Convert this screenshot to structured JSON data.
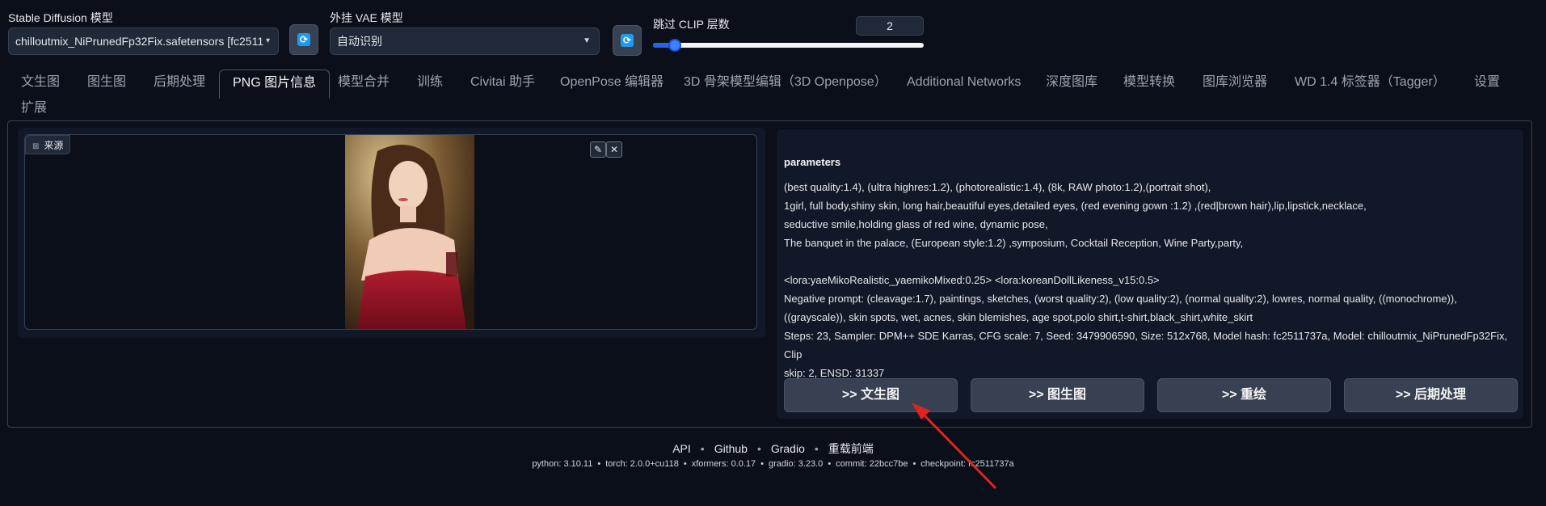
{
  "top": {
    "sd_model_label": "Stable Diffusion 模型",
    "sd_model_value": "chilloutmix_NiPrunedFp32Fix.safetensors [fc2511",
    "vae_label": "外挂 VAE 模型",
    "vae_value": "自动识别",
    "clip_label": "跳过 CLIP 层数",
    "clip_value": "2",
    "clip_fraction": 0.08
  },
  "tabs": [
    {
      "label": "文生图"
    },
    {
      "label": "图生图"
    },
    {
      "label": "后期处理"
    },
    {
      "label": "PNG 图片信息"
    },
    {
      "label": "模型合并"
    },
    {
      "label": "训练"
    },
    {
      "label": "Civitai 助手"
    },
    {
      "label": "OpenPose 编辑器"
    },
    {
      "label": "3D 骨架模型编辑（3D Openpose）"
    },
    {
      "label": "Additional Networks"
    },
    {
      "label": "深度图库"
    },
    {
      "label": "模型转换"
    },
    {
      "label": "图库浏览器"
    },
    {
      "label": "WD 1.4 标签器（Tagger）"
    },
    {
      "label": "设置"
    },
    {
      "label": "扩展"
    }
  ],
  "active_tab": "PNG 图片信息",
  "image_panel": {
    "source_label": "来源"
  },
  "info": {
    "title": "parameters",
    "text": "(best quality:1.4), (ultra highres:1.2), (photorealistic:1.4), (8k, RAW photo:1.2),(portrait shot),\n1girl, full body,shiny skin, long hair,beautiful eyes,detailed eyes, (red evening gown :1.2) ,(red|brown hair),lip,lipstick,necklace,\nseductive smile,holding glass of red wine, dynamic pose,\nThe banquet in the palace, (European style:1.2) ,symposium, Cocktail Reception, Wine Party,party,\n\n<lora:yaeMikoRealistic_yaemikoMixed:0.25> <lora:koreanDollLikeness_v15:0.5>\nNegative prompt: (cleavage:1.7), paintings, sketches, (worst quality:2), (low quality:2), (normal quality:2), lowres, normal quality, ((monochrome)),\n((grayscale)), skin spots, wet, acnes, skin blemishes, age spot,polo shirt,t-shirt,black_shirt,white_skirt\nSteps: 23, Sampler: DPM++ SDE Karras, CFG scale: 7, Seed: 3479906590, Size: 512x768, Model hash: fc2511737a, Model: chilloutmix_NiPrunedFp32Fix, Clip\nskip: 2, ENSD: 31337"
  },
  "actions": [
    {
      "label": ">> 文生图"
    },
    {
      "label": ">> 图生图"
    },
    {
      "label": ">> 重绘"
    },
    {
      "label": ">> 后期处理"
    }
  ],
  "footer": {
    "links": [
      "API",
      "Github",
      "Gradio",
      "重载前端"
    ],
    "info": [
      "python: 3.10.11",
      "torch: 2.0.0+cu118",
      "xformers: 0.0.17",
      "gradio: 3.23.0",
      "commit: 22bcc7be",
      "checkpoint: fc2511737a"
    ]
  },
  "colors": {
    "background": "#0b0f19",
    "accent": "#3b82f6",
    "annotation_arrow": "#e02424"
  }
}
